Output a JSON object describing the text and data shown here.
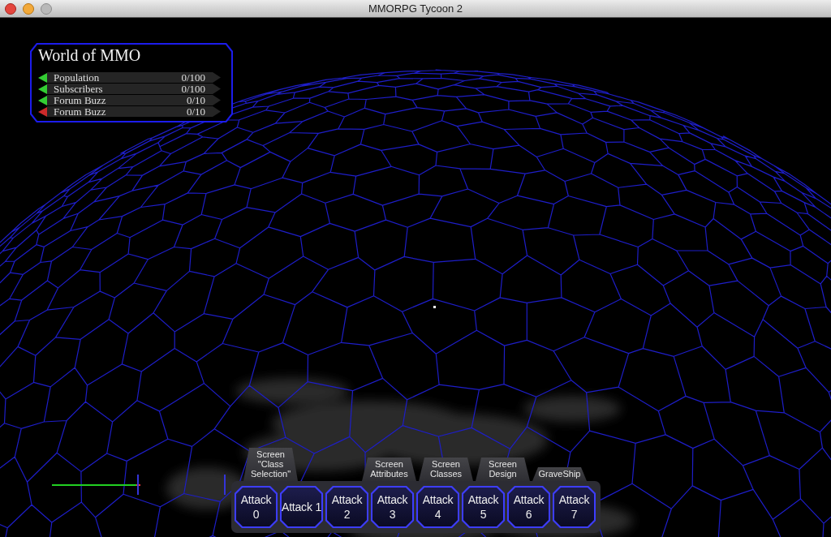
{
  "window": {
    "title": "MMORPG Tycoon 2",
    "controls": [
      {
        "kind": "close",
        "disabled": false
      },
      {
        "kind": "minimize",
        "disabled": false
      },
      {
        "kind": "zoom",
        "disabled": true
      }
    ]
  },
  "stats_panel": {
    "title": "World of MMO",
    "rows": [
      {
        "label": "Population",
        "value": "0/100",
        "color": "#33cc33"
      },
      {
        "label": "Subscribers",
        "value": "0/100",
        "color": "#33cc33"
      },
      {
        "label": "Forum Buzz",
        "value": "0/10",
        "color": "#33cc33"
      },
      {
        "label": "Forum Buzz",
        "value": "0/10",
        "color": "#cc2a2a"
      }
    ]
  },
  "screen_tabs": [
    {
      "label": "Screen \"Class Selection\""
    },
    {
      "label": "Screen Attributes"
    },
    {
      "label": "Screen Classes"
    },
    {
      "label": "Screen Design"
    },
    {
      "label": "GraveShip"
    }
  ],
  "action_buttons": [
    {
      "label": "Attack\n0"
    },
    {
      "label": "Attack 1"
    },
    {
      "label": "Attack\n2"
    },
    {
      "label": "Attack\n3"
    },
    {
      "label": "Attack\n4"
    },
    {
      "label": "Attack\n5"
    },
    {
      "label": "Attack\n6"
    },
    {
      "label": "Attack\n7"
    }
  ]
}
